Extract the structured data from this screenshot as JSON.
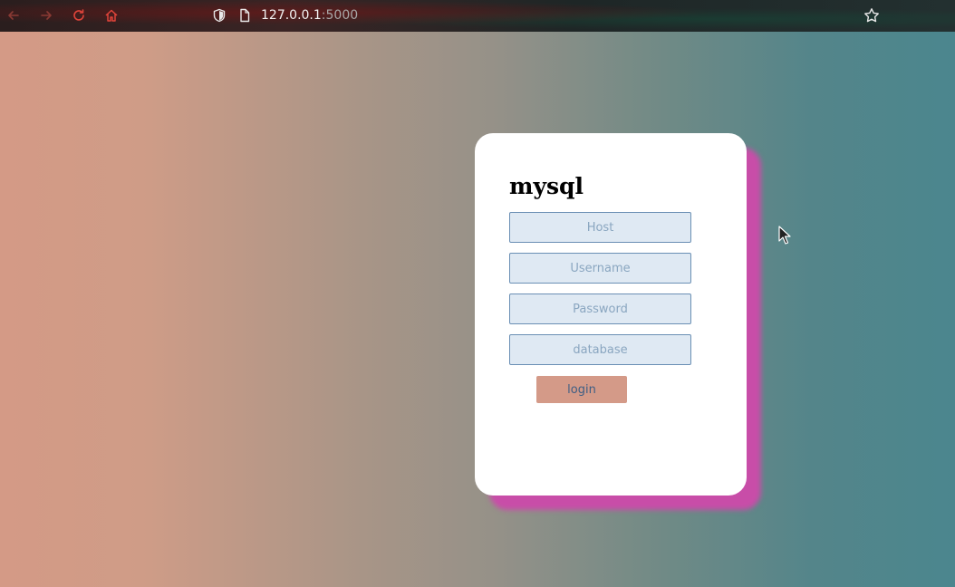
{
  "browser": {
    "url_host": "127.0.0.1",
    "url_port": ":5000",
    "icons": {
      "back": "arrow-left-icon",
      "forward": "arrow-right-icon",
      "reload": "reload-icon",
      "home": "home-icon",
      "shield": "shield-icon",
      "page": "page-icon",
      "bookmark": "star-icon"
    },
    "icon_color": "#e0443a"
  },
  "form": {
    "title": "mysql",
    "host_placeholder": "Host",
    "username_placeholder": "Username",
    "password_placeholder": "Password",
    "database_placeholder": "database",
    "login_label": "login"
  },
  "colors": {
    "gradient_left": "#d49a86",
    "gradient_right": "#4b868e",
    "card_shadow": "#c84da8",
    "input_bg": "#dfe9f3",
    "button_bg": "#d49a88"
  }
}
